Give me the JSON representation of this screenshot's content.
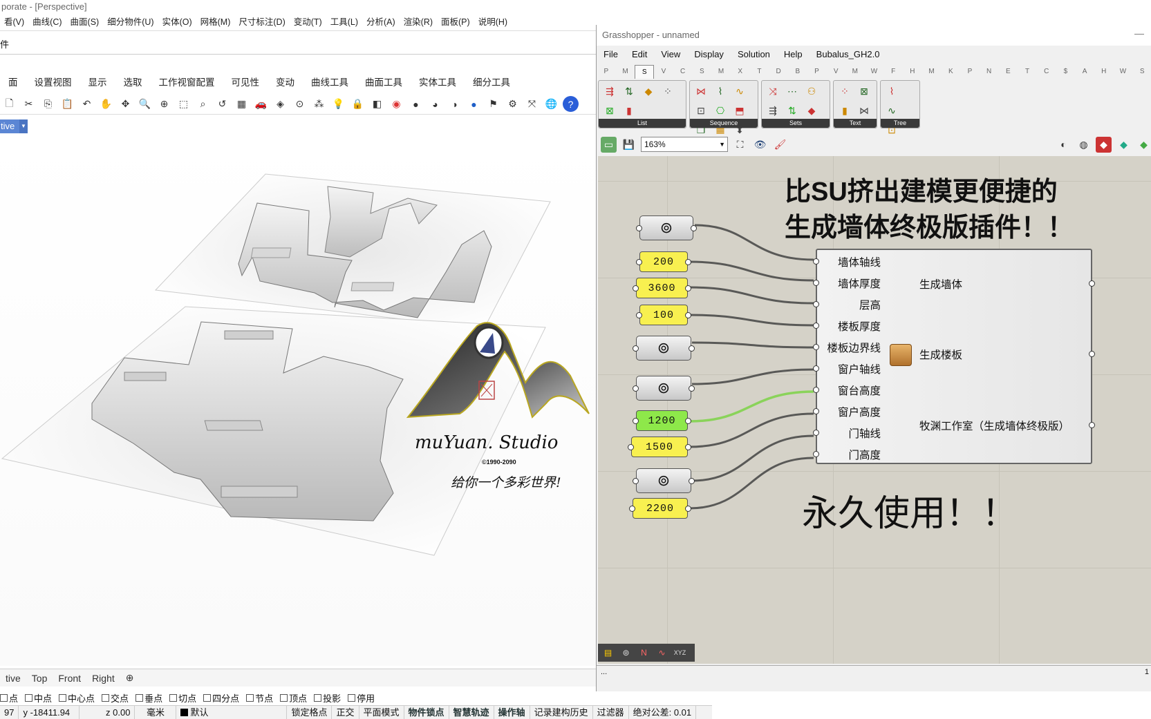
{
  "rhino": {
    "title": "porate - [Perspective]",
    "menu": [
      "看(V)",
      "曲线(C)",
      "曲面(S)",
      "细分物件(U)",
      "实体(O)",
      "网格(M)",
      "尺寸标注(D)",
      "变动(T)",
      "工具(L)",
      "分析(A)",
      "渲染(R)",
      "面板(P)",
      "说明(H)"
    ],
    "cmd_line": "件",
    "tabs": [
      "面",
      "设置视图",
      "显示",
      "选取",
      "工作视窗配置",
      "可见性",
      "变动",
      "曲线工具",
      "曲面工具",
      "实体工具",
      "细分工具"
    ],
    "toolbar_icons": [
      "new-file-icon",
      "cut-icon",
      "copy-icon",
      "paste-icon",
      "undo-icon",
      "pan-hand-icon",
      "rotate-view-icon",
      "zoom-icon",
      "zoom-window-icon",
      "zoom-extents-icon",
      "zoom-selected-icon",
      "undo-view-icon",
      "grid-icon",
      "car-icon",
      "camera-icon",
      "snap-icon",
      "point-icon",
      "light-icon",
      "lock-icon",
      "layer-icon",
      "color-wheel-icon",
      "shaded-sphere-icon",
      "rendered-sphere-icon",
      "material-sphere-icon",
      "blue-sphere-icon",
      "flag-icon",
      "gear-icon",
      "transform-icon",
      "globe-icon",
      "help-icon"
    ],
    "viewport_tab": "tive",
    "viewport_tabs": [
      "tive",
      "Top",
      "Front",
      "Right"
    ],
    "osnaps": [
      {
        "label": "点",
        "checked": false
      },
      {
        "label": "中点",
        "checked": false
      },
      {
        "label": "中心点",
        "checked": false
      },
      {
        "label": "交点",
        "checked": false
      },
      {
        "label": "垂点",
        "checked": false
      },
      {
        "label": "切点",
        "checked": false
      },
      {
        "label": "四分点",
        "checked": false
      },
      {
        "label": "节点",
        "checked": false
      },
      {
        "label": "顶点",
        "checked": false
      },
      {
        "label": "投影",
        "checked": false
      },
      {
        "label": "停用",
        "checked": false
      }
    ],
    "status": {
      "x": "97",
      "y": "y -18411.94",
      "z": "z 0.00",
      "unit": "毫米",
      "layer": "默认",
      "items": [
        "锁定格点",
        "正交",
        "平面模式",
        "物件锁点",
        "智慧轨迹",
        "操作轴",
        "记录建构历史",
        "过滤器"
      ],
      "bold_items": [
        "物件锁点",
        "智慧轨迹",
        "操作轴"
      ],
      "tolerance": "绝对公差: 0.01"
    },
    "watermark": {
      "brand": "muYuan. Studio",
      "copyright": "©1990-2090",
      "slogan": "给你一个多彩世界!"
    }
  },
  "grasshopper": {
    "title": "Grasshopper - unnamed",
    "menu": [
      "File",
      "Edit",
      "View",
      "Display",
      "Solution",
      "Help",
      "Bubalus_GH2.0"
    ],
    "category_tabs": [
      "P",
      "M",
      "S",
      "V",
      "C",
      "S",
      "M",
      "X",
      "T",
      "D",
      "B",
      "P",
      "V",
      "M",
      "W",
      "F",
      "H",
      "M",
      "K",
      "P",
      "N",
      "E",
      "T",
      "C",
      "$",
      "A",
      "H",
      "W",
      "S"
    ],
    "active_category": 2,
    "ribbon_groups": [
      {
        "label": "List",
        "icons": 6
      },
      {
        "label": "Sequence",
        "icons": 9
      },
      {
        "label": "Sets",
        "icons": 6
      },
      {
        "label": "Text",
        "icons": 4
      },
      {
        "label": "Tree",
        "icons": 4
      }
    ],
    "zoom": "163%",
    "headline1": "比SU挤出建模更便捷的",
    "headline2": "生成墙体终极版插件！！",
    "tagline": "永久使用！！",
    "sliders": [
      "200",
      "3600",
      "100",
      "1200",
      "1500",
      "2200"
    ],
    "component": {
      "inputs": [
        "墙体轴线",
        "墙体厚度",
        "层高",
        "楼板厚度",
        "楼板边界线",
        "窗户轴线",
        "窗台高度",
        "窗户高度",
        "门轴线",
        "门高度"
      ],
      "outputs": [
        "生成墙体",
        "生成楼板",
        "牧渊工作室（生成墙体终极版）"
      ]
    },
    "footer": "...",
    "footer_right": "1"
  },
  "colors": {
    "slider_yellow": "#f8f050",
    "slider_green": "#8ee84a",
    "viewport_tab": "#5b86d4",
    "canvas": "#d5d2c8"
  }
}
